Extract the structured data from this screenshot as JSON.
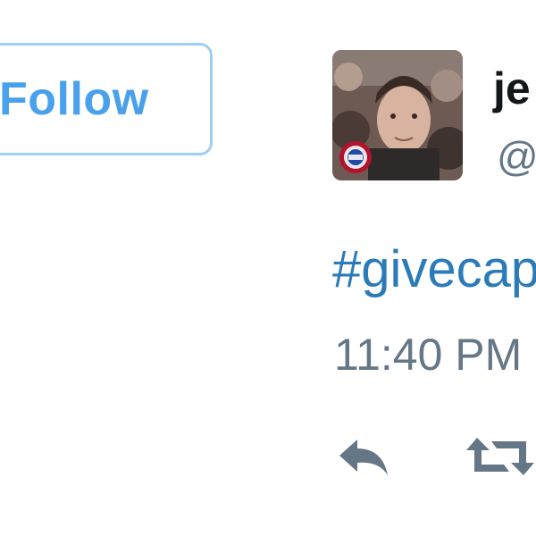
{
  "follow_button": {
    "label": "Follow"
  },
  "tweet": {
    "author": {
      "display_name": "je",
      "handle": "@",
      "avatar_icon": "profile-photo"
    },
    "text_hashtag": "#givecap",
    "timestamp": "11:40 PM",
    "actions": [
      {
        "name": "reply",
        "icon": "reply-icon"
      },
      {
        "name": "retweet",
        "icon": "retweet-icon"
      }
    ]
  },
  "colors": {
    "follow_blue": "#4aa1eb",
    "follow_border": "#9fcdf3",
    "link_blue": "#2b7bb9",
    "muted_gray": "#657786",
    "name_black": "#14171a"
  }
}
